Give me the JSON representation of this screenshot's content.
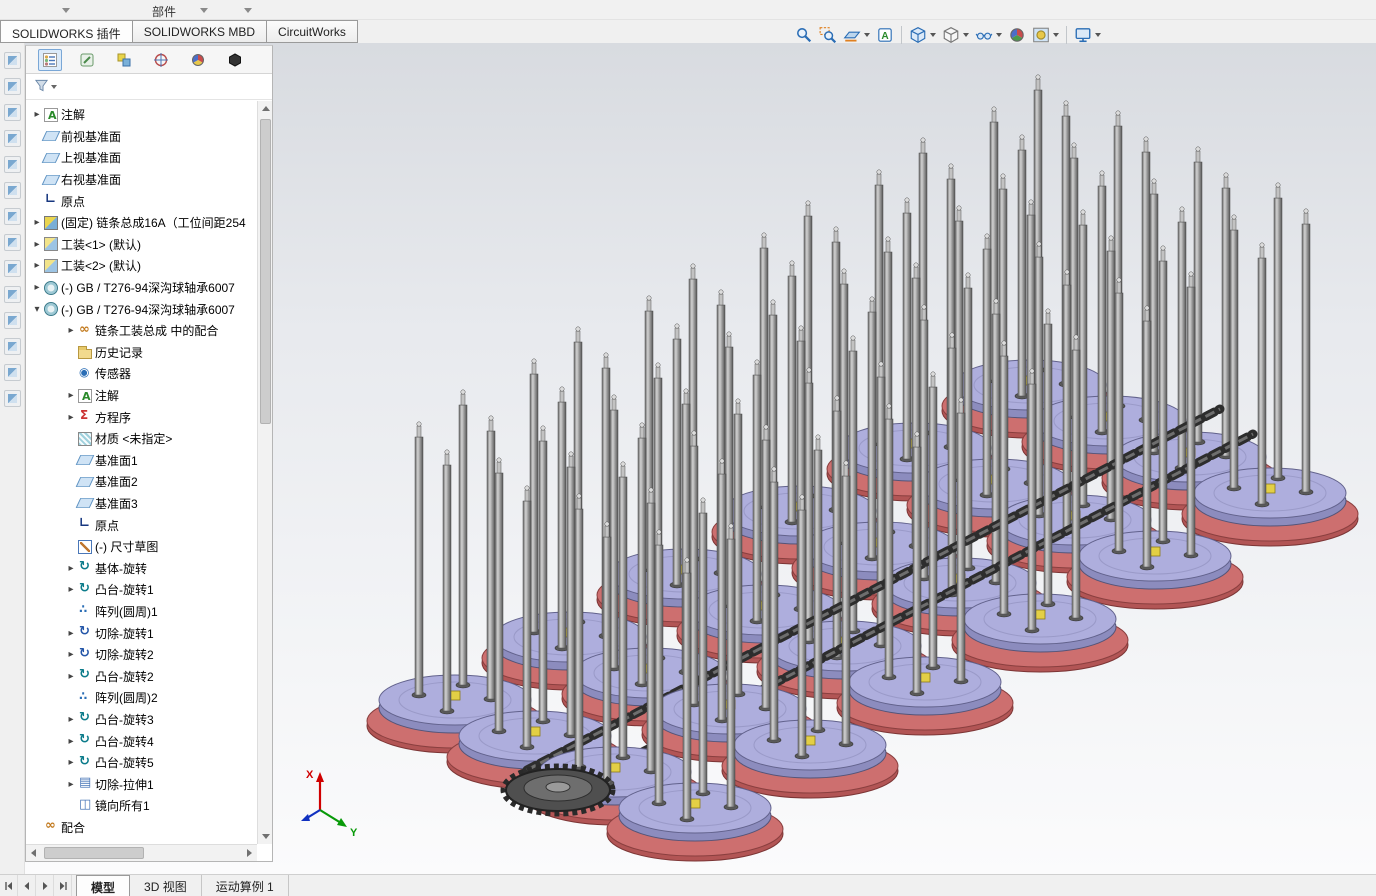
{
  "top_bar": {
    "partial_menu_label": "部件",
    "addin_tabs": [
      "SOLIDWORKS 插件",
      "SOLIDWORKS MBD",
      "CircuitWorks"
    ]
  },
  "view_toolbar": {
    "buttons": [
      {
        "name": "zoom-fit",
        "dropdown": false
      },
      {
        "name": "zoom-area",
        "dropdown": false
      },
      {
        "name": "section-view",
        "dropdown": true
      },
      {
        "name": "annotation-view",
        "dropdown": false
      },
      {
        "name": "view-orientation",
        "dropdown": true
      },
      {
        "name": "display-style",
        "dropdown": true
      },
      {
        "name": "hide-show-items",
        "dropdown": true
      },
      {
        "name": "edit-appearance",
        "dropdown": false
      },
      {
        "name": "apply-scene",
        "dropdown": true
      },
      {
        "name": "view-settings",
        "dropdown": true
      }
    ]
  },
  "left_toolbar": {
    "icon_count": 14
  },
  "feature_tree": {
    "toolbar": [
      {
        "name": "featuremanager-tree",
        "active": true
      },
      {
        "name": "propertymanager",
        "active": false
      },
      {
        "name": "configurationmanager",
        "active": false
      },
      {
        "name": "dimxpertmanager",
        "active": false
      },
      {
        "name": "displaymanager",
        "active": false
      },
      {
        "name": "cam",
        "active": false
      }
    ],
    "items": [
      {
        "label": "注解",
        "icon": "annotation",
        "indent": 0,
        "expander": "collapsed"
      },
      {
        "label": "前视基准面",
        "icon": "plane",
        "indent": 0,
        "expander": null
      },
      {
        "label": "上视基准面",
        "icon": "plane",
        "indent": 0,
        "expander": null
      },
      {
        "label": "右视基准面",
        "icon": "plane",
        "indent": 0,
        "expander": null
      },
      {
        "label": "原点",
        "icon": "origin",
        "indent": 0,
        "expander": null
      },
      {
        "label": "(固定) 链条总成16A（工位间距254",
        "icon": "assembly",
        "indent": 0,
        "expander": "collapsed"
      },
      {
        "label": "工装<1> (默认)",
        "icon": "part",
        "indent": 0,
        "expander": "collapsed"
      },
      {
        "label": "工装<2> (默认)",
        "icon": "part",
        "indent": 0,
        "expander": "collapsed"
      },
      {
        "label": "(-) GB / T276-94深沟球轴承6007",
        "icon": "bearing",
        "indent": 0,
        "expander": "collapsed"
      },
      {
        "label": "(-) GB / T276-94深沟球轴承6007",
        "icon": "bearing",
        "indent": 0,
        "expander": "expanded"
      },
      {
        "label": "链条工装总成 中的配合",
        "icon": "mates",
        "indent": 1,
        "expander": "collapsed"
      },
      {
        "label": "历史记录",
        "icon": "history",
        "indent": 1,
        "expander": null
      },
      {
        "label": "传感器",
        "icon": "sensor",
        "indent": 1,
        "expander": null
      },
      {
        "label": "注解",
        "icon": "annotation",
        "indent": 1,
        "expander": "collapsed"
      },
      {
        "label": "方程序",
        "icon": "equations",
        "indent": 1,
        "expander": "collapsed"
      },
      {
        "label": "材质 <未指定>",
        "icon": "material",
        "indent": 1,
        "expander": null
      },
      {
        "label": "基准面1",
        "icon": "plane",
        "indent": 1,
        "expander": null
      },
      {
        "label": "基准面2",
        "icon": "plane",
        "indent": 1,
        "expander": null
      },
      {
        "label": "基准面3",
        "icon": "plane",
        "indent": 1,
        "expander": null
      },
      {
        "label": "原点",
        "icon": "origin",
        "indent": 1,
        "expander": null
      },
      {
        "label": "(-) 尺寸草图",
        "icon": "sketch",
        "indent": 1,
        "expander": null
      },
      {
        "label": "基体-旋转",
        "icon": "revolve",
        "indent": 1,
        "expander": "collapsed"
      },
      {
        "label": "凸台-旋转1",
        "icon": "revolve",
        "indent": 1,
        "expander": "collapsed"
      },
      {
        "label": "阵列(圆周)1",
        "icon": "pattern",
        "indent": 1,
        "expander": null
      },
      {
        "label": "切除-旋转1",
        "icon": "cut-revolve",
        "indent": 1,
        "expander": "collapsed"
      },
      {
        "label": "切除-旋转2",
        "icon": "cut-revolve",
        "indent": 1,
        "expander": "collapsed"
      },
      {
        "label": "凸台-旋转2",
        "icon": "revolve",
        "indent": 1,
        "expander": "collapsed"
      },
      {
        "label": "阵列(圆周)2",
        "icon": "pattern",
        "indent": 1,
        "expander": null
      },
      {
        "label": "凸台-旋转3",
        "icon": "revolve",
        "indent": 1,
        "expander": "collapsed"
      },
      {
        "label": "凸台-旋转4",
        "icon": "revolve",
        "indent": 1,
        "expander": "collapsed"
      },
      {
        "label": "凸台-旋转5",
        "icon": "revolve",
        "indent": 1,
        "expander": "collapsed"
      },
      {
        "label": "切除-拉伸1",
        "icon": "extrude-cut",
        "indent": 1,
        "expander": "collapsed"
      },
      {
        "label": "镜向所有1",
        "icon": "mirror",
        "indent": 1,
        "expander": null
      },
      {
        "label": "配合",
        "icon": "mates",
        "indent": 0,
        "expander": null
      }
    ]
  },
  "viewport": {
    "triad": {
      "x_label": "X",
      "y_label": "Y"
    }
  },
  "status_bar": {
    "tabs": [
      {
        "label": "模型",
        "active": true
      },
      {
        "label": "3D 视图",
        "active": false
      },
      {
        "label": "运动算例 1",
        "active": false
      }
    ]
  }
}
